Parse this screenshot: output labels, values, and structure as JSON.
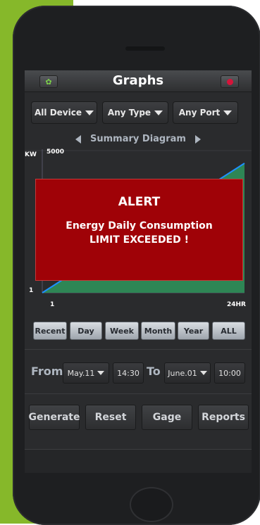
{
  "header": {
    "title": "Graphs"
  },
  "filters": {
    "device": "All Device",
    "type": "Any Type",
    "port": "Any Port"
  },
  "diagram_nav": {
    "label": "Summary Diagram"
  },
  "chart_data": {
    "type": "area",
    "x": [
      1,
      24
    ],
    "xtick_labels": [
      "1",
      "24HR"
    ],
    "ylabel": "KW",
    "ytick_labels": [
      "5000",
      "1"
    ],
    "ylim": [
      1,
      5000
    ],
    "series": [
      {
        "values": [
          1,
          5000
        ]
      }
    ],
    "colors": {
      "fill": "#2e8b57",
      "line": "#1e90ff"
    }
  },
  "alert": {
    "title": "ALERT",
    "line1": "Energy Daily Consumption",
    "line2": "LIMIT EXCEEDED !"
  },
  "ranges": [
    "Recent",
    "Day",
    "Week",
    "Month",
    "Year",
    "ALL"
  ],
  "date_range": {
    "from_label": "From",
    "from_date": "May.11",
    "from_time": "14:30",
    "to_label": "To",
    "to_date": "June.01",
    "to_time": "10:00"
  },
  "actions": {
    "generate": "Generate",
    "reset": "Reset",
    "gage": "Gage",
    "reports": "Reports"
  },
  "colors": {
    "brand_green": "#86b82a",
    "alert_red": "#9f0207",
    "indicator_red": "#d6143a",
    "indicator_green": "#7dd34a"
  }
}
